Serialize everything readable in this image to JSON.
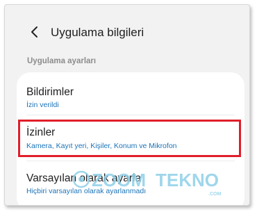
{
  "header": {
    "title": "Uygulama bilgileri",
    "back_icon": "back-arrow-icon"
  },
  "section": {
    "label": "Uygulama ayarları"
  },
  "settings": [
    {
      "title": "Bildirimler",
      "subtitle": "İzin verildi"
    },
    {
      "title": "İzinler",
      "subtitle": "Kamera, Kayıt yeri, Kişiler, Konum ve Mikrofon",
      "highlighted": true
    },
    {
      "title": "Varsayılan olarak ayarla",
      "subtitle": "Hiçbiri varsayılan olarak ayarlanmadı"
    }
  ],
  "watermark": {
    "word1": "ZOOM",
    "word2": "TEKNO",
    "suffix": ".COM"
  },
  "colors": {
    "highlight_border": "#e01e2b",
    "subtitle_blue": "#1a73b8",
    "watermark": "#8fd0e8"
  }
}
